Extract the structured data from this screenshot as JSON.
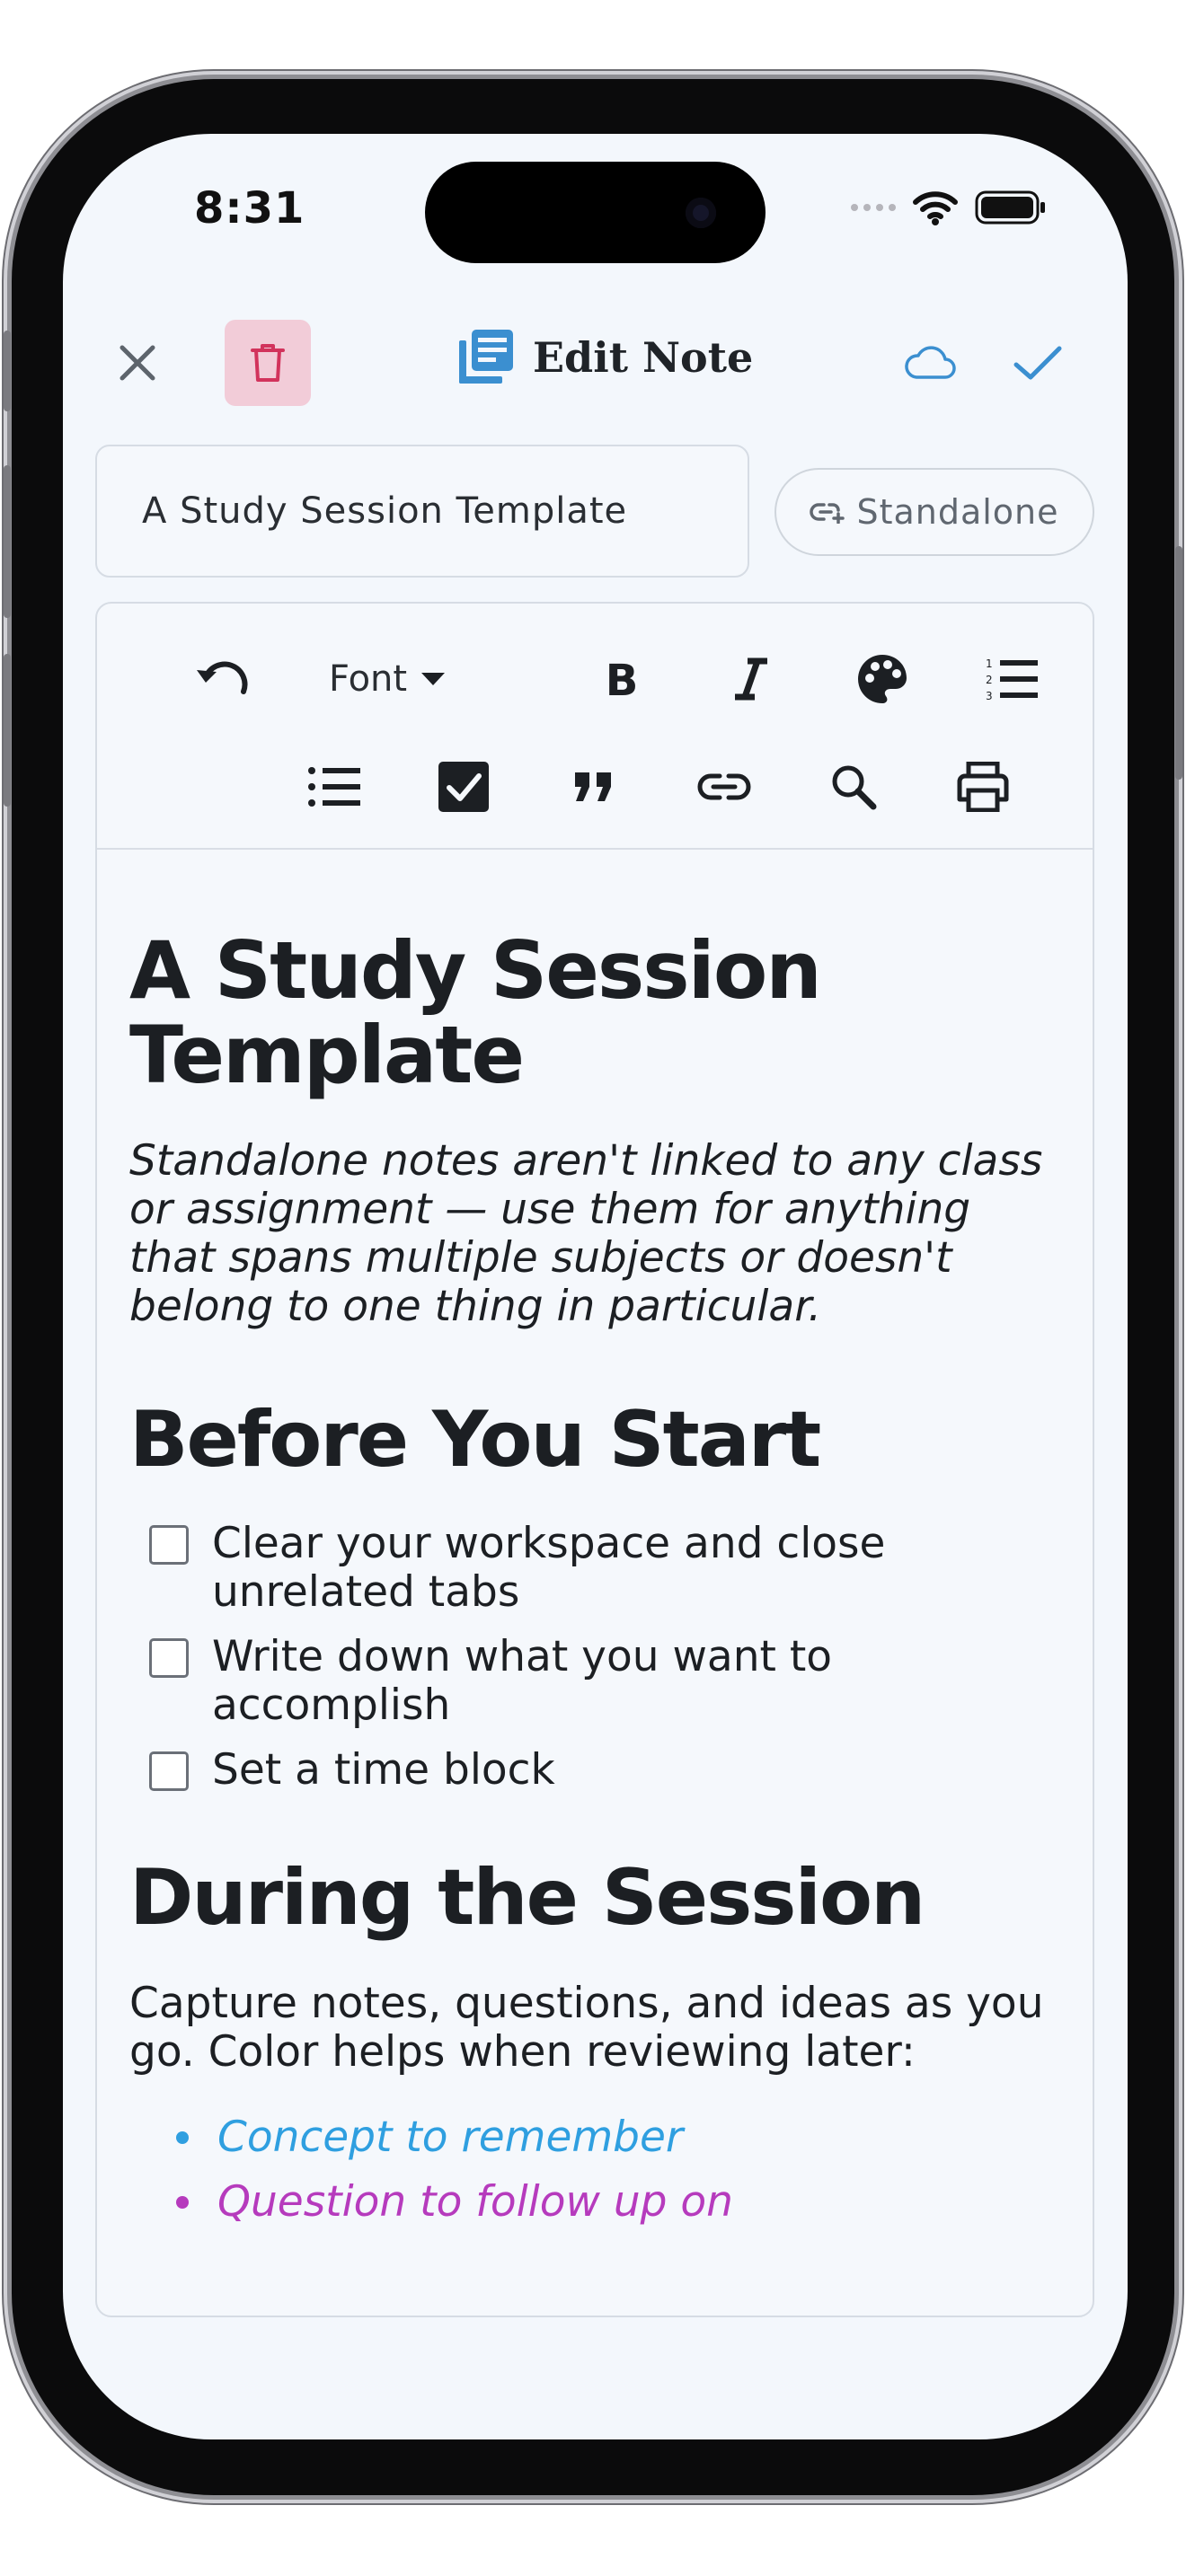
{
  "status": {
    "time": "8:31"
  },
  "header": {
    "title": "Edit Note"
  },
  "note_title_input": {
    "value": "A Study Session Template"
  },
  "link_pill": {
    "label": "Standalone"
  },
  "toolbar": {
    "font_label": "Font"
  },
  "document": {
    "heading": "A Study Session Template",
    "intro": "Standalone notes aren't linked to any class or assignment — use them for anything that spans multiple subjects or doesn't belong to one thing in particular.",
    "section1": {
      "heading": "Before You Start",
      "checklist": [
        {
          "text": "Clear your workspace and close unrelated tabs",
          "checked": false
        },
        {
          "text": "Write down what you want to accomplish",
          "checked": false
        },
        {
          "text": "Set a time block",
          "checked": false
        }
      ]
    },
    "section2": {
      "heading": "During the Session",
      "paragraph": "Capture notes, questions, and ideas as you go. Color helps when reviewing later:",
      "bullets": [
        {
          "text": "Concept to remember",
          "color": "#2f9fe0"
        },
        {
          "text": "Question to follow up on",
          "color": "#b63bbd"
        }
      ]
    }
  },
  "colors": {
    "accent": "#3b8fd0",
    "delete_bg": "#f2ccd8",
    "delete_icon": "#d2335c",
    "screen_bg": "#f3f7fc"
  }
}
